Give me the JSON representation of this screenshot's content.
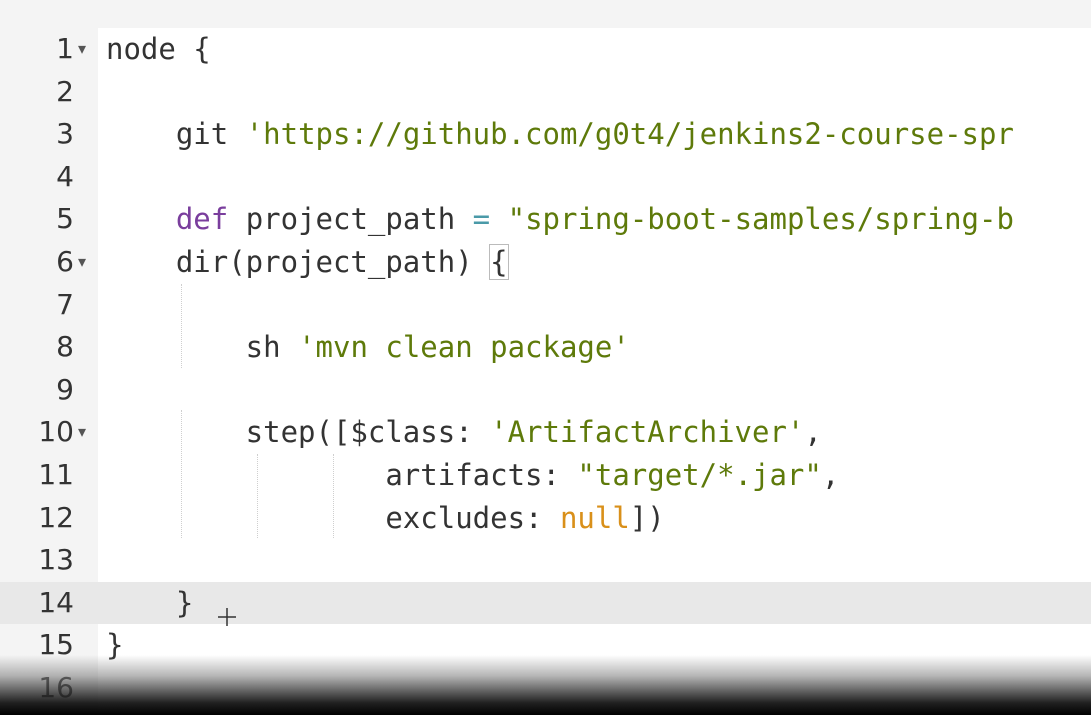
{
  "editor": {
    "lines": [
      {
        "n": "1",
        "fold": true,
        "tokens": [
          {
            "t": "node {",
            "c": "plain"
          }
        ]
      },
      {
        "n": "2",
        "fold": false,
        "tokens": []
      },
      {
        "n": "3",
        "fold": false,
        "tokens": [
          {
            "t": "    git ",
            "c": "plain"
          },
          {
            "t": "'https://github.com/g0t4/jenkins2-course-spr",
            "c": "string"
          }
        ]
      },
      {
        "n": "4",
        "fold": false,
        "tokens": []
      },
      {
        "n": "5",
        "fold": false,
        "tokens": [
          {
            "t": "    ",
            "c": "plain"
          },
          {
            "t": "def",
            "c": "keyword"
          },
          {
            "t": " project_path ",
            "c": "plain"
          },
          {
            "t": "=",
            "c": "op"
          },
          {
            "t": " ",
            "c": "plain"
          },
          {
            "t": "\"spring-boot-samples/spring-b",
            "c": "string"
          }
        ]
      },
      {
        "n": "6",
        "fold": true,
        "tokens": [
          {
            "t": "    dir(project_path) ",
            "c": "plain"
          },
          {
            "t": "{",
            "c": "bracket"
          }
        ]
      },
      {
        "n": "7",
        "fold": false,
        "tokens": []
      },
      {
        "n": "8",
        "fold": false,
        "tokens": [
          {
            "t": "        sh ",
            "c": "plain"
          },
          {
            "t": "'mvn clean package'",
            "c": "string"
          }
        ]
      },
      {
        "n": "9",
        "fold": false,
        "tokens": []
      },
      {
        "n": "10",
        "fold": true,
        "tokens": [
          {
            "t": "        step([$class: ",
            "c": "plain"
          },
          {
            "t": "'ArtifactArchiver'",
            "c": "string"
          },
          {
            "t": ",",
            "c": "plain"
          }
        ]
      },
      {
        "n": "11",
        "fold": false,
        "tokens": [
          {
            "t": "                artifacts: ",
            "c": "plain"
          },
          {
            "t": "\"target/*.jar\"",
            "c": "string"
          },
          {
            "t": ",",
            "c": "plain"
          }
        ]
      },
      {
        "n": "12",
        "fold": false,
        "tokens": [
          {
            "t": "                excludes: ",
            "c": "plain"
          },
          {
            "t": "null",
            "c": "null"
          },
          {
            "t": "])",
            "c": "plain"
          }
        ]
      },
      {
        "n": "13",
        "fold": false,
        "tokens": []
      },
      {
        "n": "14",
        "fold": false,
        "active": true,
        "tokens": [
          {
            "t": "    }",
            "c": "plain"
          }
        ]
      },
      {
        "n": "15",
        "fold": false,
        "tokens": [
          {
            "t": "}",
            "c": "plain"
          }
        ]
      },
      {
        "n": "16",
        "fold": false,
        "tokens": []
      }
    ],
    "fold_glyph": "▾",
    "cursor_glyph": "+"
  },
  "colors": {
    "string": "#5e7a0a",
    "keyword": "#7a3e9d",
    "operator": "#4a9aa8",
    "null": "#d9901a",
    "text": "#333333",
    "gutter_bg": "#f4f4f4",
    "active_line_bg": "#e8e8e8"
  }
}
